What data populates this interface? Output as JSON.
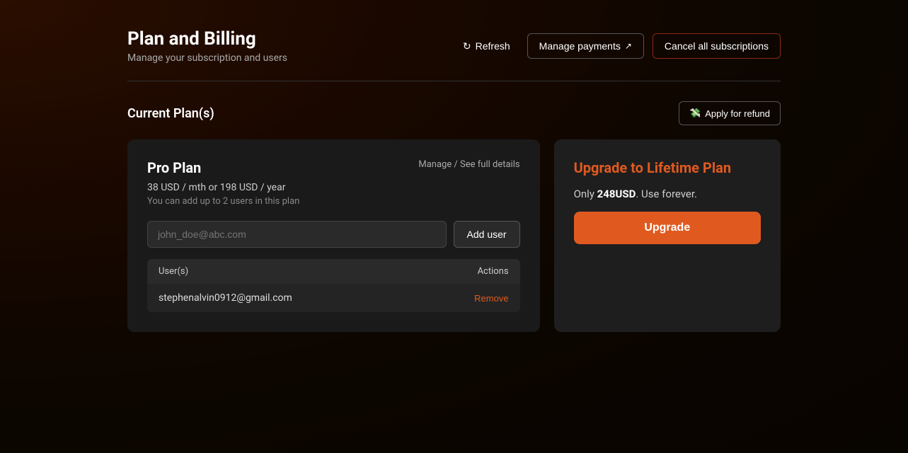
{
  "page": {
    "title": "Plan and Billing",
    "subtitle": "Manage your subscription and users"
  },
  "header": {
    "refresh_label": "Refresh",
    "manage_payments_label": "Manage payments",
    "cancel_subscriptions_label": "Cancel all subscriptions"
  },
  "section": {
    "current_plans_title": "Current Plan(s)",
    "apply_refund_label": "Apply for refund"
  },
  "pro_plan": {
    "name": "Pro Plan",
    "manage_link": "Manage / See full details",
    "price": "38 USD / mth or 198 USD / year",
    "users_info": "You can add up to 2 users in this plan",
    "user_input_placeholder": "john_doe@abc.com",
    "add_user_button": "Add user",
    "table_header_users": "User(s)",
    "table_header_actions": "Actions",
    "user_row_email": "stephenalvin0912@gmail.com",
    "remove_label": "Remove"
  },
  "upgrade_card": {
    "title_prefix": "Upgrade to ",
    "title_highlight": "Lifetime Plan",
    "price_prefix": "Only ",
    "price_value": "248USD",
    "price_suffix": ". Use forever.",
    "upgrade_button": "Upgrade"
  },
  "icons": {
    "refresh": "↻",
    "external": "↗",
    "refund": "💸"
  },
  "colors": {
    "accent": "#e05a20",
    "background": "#0d0600",
    "card_bg": "#1a1a1a",
    "border": "#444444"
  }
}
